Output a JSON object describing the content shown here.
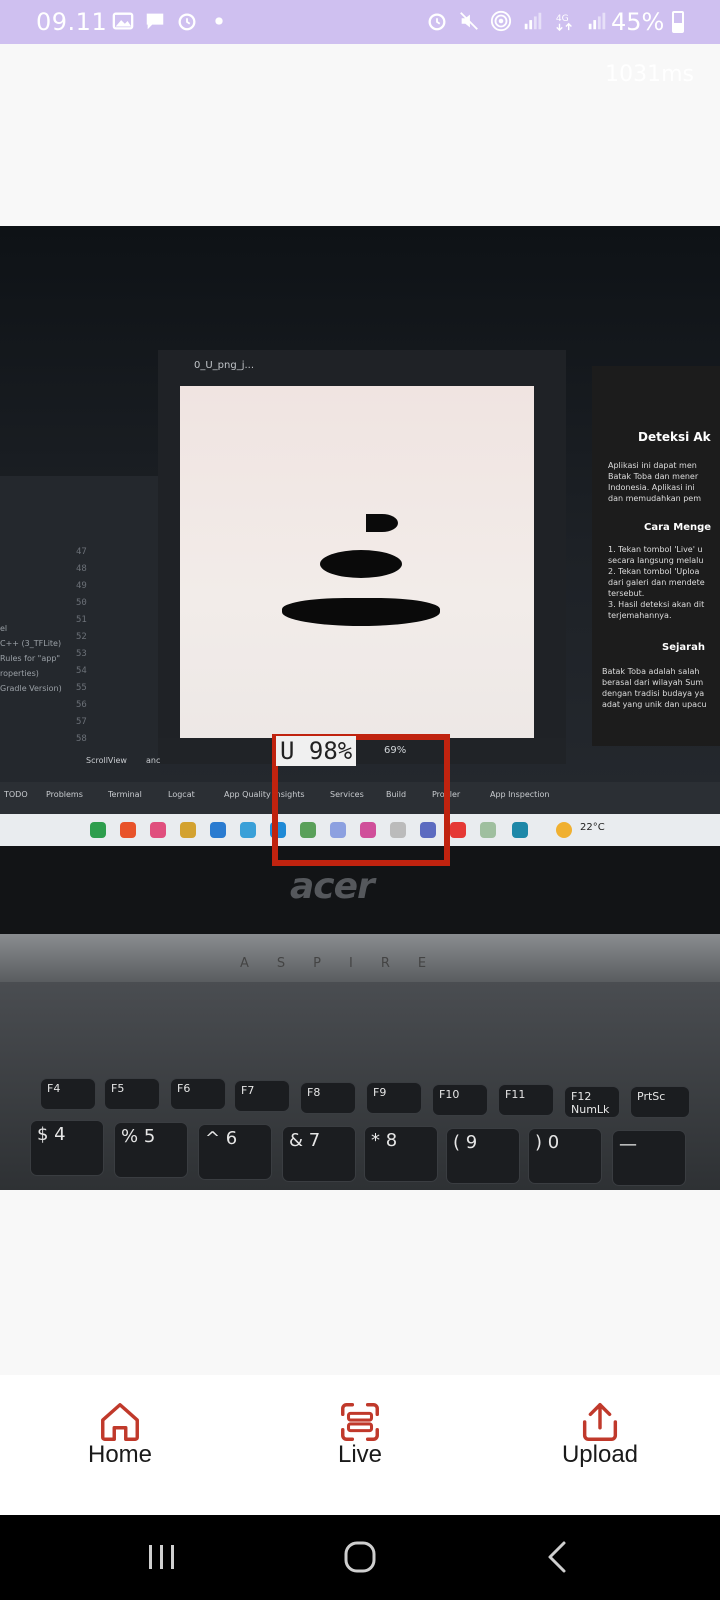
{
  "status_bar": {
    "time": "09.11",
    "left_icons": [
      "image-icon",
      "message-icon",
      "alarm-icon",
      "dot-icon"
    ],
    "right_icons": [
      "alarm-icon",
      "mute-icon",
      "hotspot-icon",
      "signal-icon",
      "4g-icon",
      "signal-icon"
    ],
    "battery": "45%"
  },
  "inference_time": "1031ms",
  "camera": {
    "photo_window_title": "0_U_png_j...",
    "zoom": "69%",
    "detection": {
      "label": "U 98%",
      "box_color": "#c0230f"
    },
    "right_panel": {
      "title": "Deteksi Ak",
      "body": [
        "Aplikasi ini dapat men",
        "Batak Toba dan mener",
        "Indonesia. Aplikasi ini",
        "dan memudahkan pem"
      ],
      "subtitle1": "Cara Menge",
      "body2": [
        "1. Tekan tombol 'Live' u",
        "secara langsung melalu",
        "2. Tekan tombol 'Uploa",
        "dari galeri dan mendete",
        "tersebut.",
        "3. Hasil deteksi akan dit",
        "terjemahannya."
      ],
      "subtitle2": "Sejarah",
      "body3": [
        "Batak Toba adalah salah",
        "berasal dari wilayah Sum",
        "dengan tradisi budaya ya",
        "adat yang unik dan upacu"
      ]
    },
    "ide_tabs": [
      "TODO",
      "Problems",
      "Terminal",
      "Logcat",
      "App Quality Insights",
      "Services",
      "Build",
      "Profiler",
      "App Inspection"
    ],
    "gutter_numbers": [
      "47",
      "48",
      "49",
      "50",
      "51",
      "52",
      "53",
      "54",
      "55",
      "56",
      "57",
      "58"
    ],
    "left_text": [
      "el",
      "",
      "",
      "",
      "",
      "C++ (3_TFLite)",
      "",
      "Rules for \"app\"",
      "roperties)",
      "Gradle Version)"
    ],
    "scroll_labels": [
      "ScrollView",
      "anc"
    ],
    "taskbar_temp": "22°C",
    "laptop_brand": "acer",
    "laptop_model": "ASPIRE",
    "keys": [
      "F4",
      "F5",
      "F6",
      "F7",
      "F8",
      "F9",
      "F10",
      "F11",
      "F12 NumLk",
      "PrtSc",
      "$ 4",
      "% 5",
      "^ 6",
      "& 7",
      "* 8",
      "( 9",
      ") 0",
      "—"
    ]
  },
  "bottom_nav": {
    "items": [
      {
        "label": "Home",
        "icon": "home-icon"
      },
      {
        "label": "Live",
        "icon": "scan-icon"
      },
      {
        "label": "Upload",
        "icon": "upload-icon"
      }
    ],
    "accent_color": "#c0392b"
  },
  "system_nav": {
    "buttons": [
      "recents-icon",
      "home-circle-icon",
      "back-icon"
    ]
  }
}
